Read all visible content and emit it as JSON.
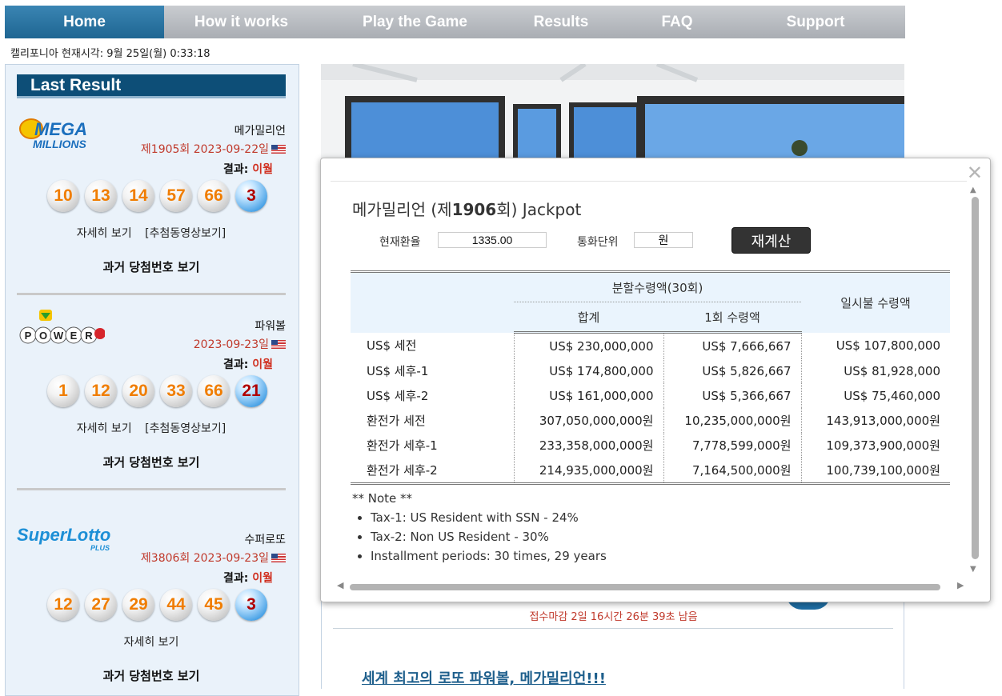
{
  "nav": {
    "items": [
      {
        "label": "Home",
        "active": true
      },
      {
        "label": "How it works",
        "active": false
      },
      {
        "label": "Play the Game",
        "active": false
      },
      {
        "label": "Results",
        "active": false
      },
      {
        "label": "FAQ",
        "active": false
      },
      {
        "label": "Support",
        "active": false
      }
    ]
  },
  "clock": "캘리포니아 현재시각: 9월 25일(월) 0:33:18",
  "sidebar": {
    "title": "Last Result",
    "lotteries": [
      {
        "name": "메가밀리언",
        "draw": "제1905회 2023-09-22일",
        "result_label": "결과:",
        "result_day": "이월",
        "numbers": [
          "10",
          "13",
          "14",
          "57",
          "66"
        ],
        "bonus": "3",
        "details_link": "자세히 보기",
        "video_link": "[추첨동영상보기]",
        "past_link": "과거 당첨번호 보기",
        "logo": "mega-millions-logo"
      },
      {
        "name": "파워볼",
        "draw": "2023-09-23일",
        "result_label": "결과:",
        "result_day": "이월",
        "numbers": [
          "1",
          "12",
          "20",
          "33",
          "66"
        ],
        "bonus": "21",
        "details_link": "자세히 보기",
        "video_link": "[추첨동영상보기]",
        "past_link": "과거 당첨번호 보기",
        "logo": "powerball-logo"
      },
      {
        "name": "수퍼로또",
        "draw": "제3806회 2023-09-23일",
        "result_label": "결과:",
        "result_day": "이월",
        "numbers": [
          "12",
          "27",
          "29",
          "44",
          "45"
        ],
        "bonus": "3",
        "details_link": "자세히 보기",
        "past_link": "과거 당첨번호 보기",
        "logo": "superlotto-plus-logo"
      }
    ]
  },
  "main": {
    "deadline": "접수마감 2일  16시간  26분  39초 남음",
    "headline": "세계 최고의 로또 파워볼, 메가밀리언!!!"
  },
  "popup": {
    "title_prefix": "메가밀리언 (제",
    "title_draw": "1906",
    "title_suffix": "회) Jackpot",
    "exchange_rate_label": "현재환율",
    "exchange_rate_value": "1335.00",
    "currency_unit_label": "통화단위",
    "currency_unit_value": "원",
    "recalc_button": "재계산",
    "table": {
      "header_installment": "분할수령액(30회)",
      "header_total": "합계",
      "header_per_payment": "1회 수령액",
      "header_lump_sum": "일시불 수령액",
      "rows": [
        {
          "label": "US$ 세전",
          "total": "US$ 230,000,000",
          "per": "US$ 7,666,667",
          "lump": "US$ 107,800,000"
        },
        {
          "label": "US$ 세후-1",
          "total": "US$ 174,800,000",
          "per": "US$ 5,826,667",
          "lump": "US$ 81,928,000"
        },
        {
          "label": "US$ 세후-2",
          "total": "US$ 161,000,000",
          "per": "US$ 5,366,667",
          "lump": "US$ 75,460,000"
        },
        {
          "label": "환전가 세전",
          "total": "307,050,000,000원",
          "per": "10,235,000,000원",
          "lump": "143,913,000,000원"
        },
        {
          "label": "환전가 세후-1",
          "total": "233,358,000,000원",
          "per": "7,778,599,000원",
          "lump": "109,373,900,000원"
        },
        {
          "label": "환전가 세후-2",
          "total": "214,935,000,000원",
          "per": "7,164,500,000원",
          "lump": "100,739,100,000원"
        }
      ]
    },
    "note_title": "** Note **",
    "notes": [
      "Tax-1: US Resident with SSN - 24%",
      "Tax-2: Non US Resident - 30%",
      "Installment periods: 30 times, 29 years"
    ]
  },
  "colors": {
    "nav_active": "#2a77a6",
    "sidebar_header": "#0d4e77",
    "red_text": "#c0392b",
    "ball_number": "#f07d00",
    "bonus_ball": "#4ba3e6"
  }
}
